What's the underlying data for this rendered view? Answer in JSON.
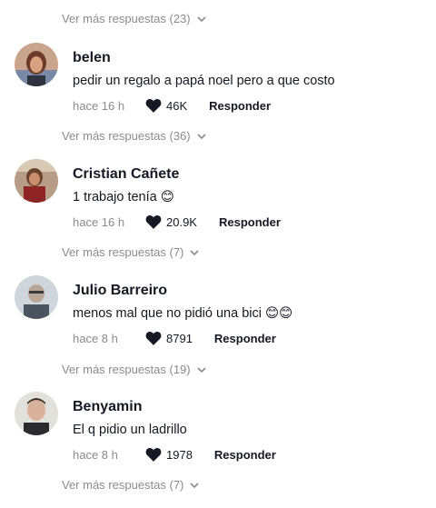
{
  "more_label_prefix": "Ver más respuestas",
  "replies_header": {
    "label": "Ver más respuestas (23)"
  },
  "comments": [
    {
      "username": "belen",
      "text": "pedir un regalo a papá noel pero a que costo",
      "time": "hace 16 h",
      "likes": "46K",
      "reply_label": "Responder",
      "more_replies": "Ver más respuestas (36)"
    },
    {
      "username": "Cristian Cañete",
      "text": "1 trabajo tenía 😊",
      "time": "hace 16 h",
      "likes": "20.9K",
      "reply_label": "Responder",
      "more_replies": "Ver más respuestas (7)"
    },
    {
      "username": "Julio Barreiro",
      "text": "menos mal que no pidió una bici 😊😊",
      "time": "hace 8 h",
      "likes": "8791",
      "reply_label": "Responder",
      "more_replies": "Ver más respuestas (19)"
    },
    {
      "username": "Benyamin",
      "text": "El q pidio un ladrillo",
      "time": "hace 8 h",
      "likes": "1978",
      "reply_label": "Responder",
      "more_replies": "Ver más respuestas (7)"
    }
  ],
  "colors": {
    "muted": "#8a8b91",
    "text": "#161823",
    "heart": "#161823"
  },
  "icons": {
    "heart": "heart-icon",
    "chevron": "chevron-down-icon"
  }
}
